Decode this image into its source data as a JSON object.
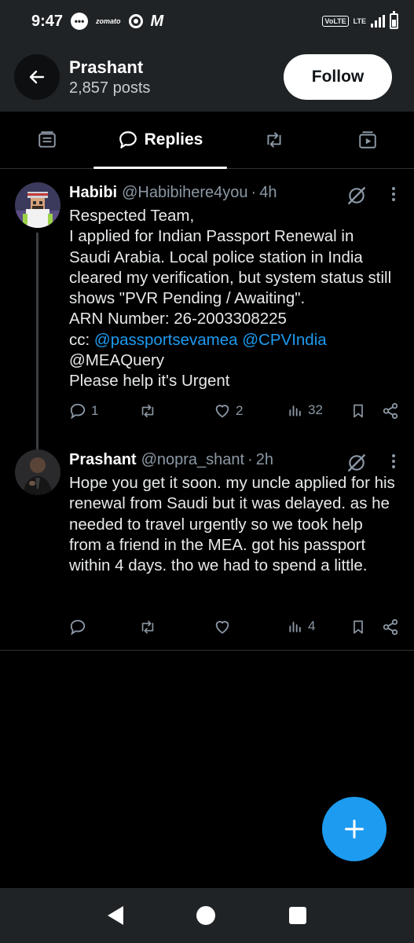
{
  "status_bar": {
    "time": "9:47",
    "zomato": "zomato",
    "m_logo": "M",
    "volte": "VoLTE",
    "lte": "LTE"
  },
  "header": {
    "name": "Prashant",
    "posts": "2,857 posts",
    "follow_label": "Follow"
  },
  "tabs": [
    {
      "icon": "article-icon",
      "label": ""
    },
    {
      "icon": "reply-bubble-icon",
      "label": "Replies"
    },
    {
      "icon": "retweet-icon",
      "label": ""
    },
    {
      "icon": "media-icon",
      "label": ""
    }
  ],
  "tweets": [
    {
      "name": "Habibi",
      "handle": "@Habibihere4you",
      "dot": "·",
      "time": "4h",
      "lines": [
        "Respected Team,",
        "I applied for Indian Passport Renewal in Saudi Arabia. Local police station in India cleared my verification, but system status still shows \"PVR Pending / Awaiting\".",
        "ARN Number: 26-2003308225"
      ],
      "cc_prefix": "cc: ",
      "mention1": "@passportsevamea",
      "mention2": "@CPVIndia",
      "mention3": "@MEAQuery",
      "last_line": "Please help it's Urgent",
      "replies": "1",
      "retweets": "",
      "likes": "2",
      "views": "32"
    },
    {
      "name": "Prashant",
      "handle": "@nopra_shant",
      "dot": "·",
      "time": "2h",
      "text": "Hope you get it soon. my uncle applied for his renewal from Saudi but it was delayed. as he needed to travel urgently so we took help from a friend in the MEA. got his passport within 4 days. tho we had to spend a little.",
      "replies": "",
      "retweets": "",
      "likes": "",
      "views": "4"
    }
  ],
  "colors": {
    "accent": "#1d9bf0",
    "background": "#000000",
    "bar": "#1f2326",
    "muted": "#8b98a5"
  }
}
